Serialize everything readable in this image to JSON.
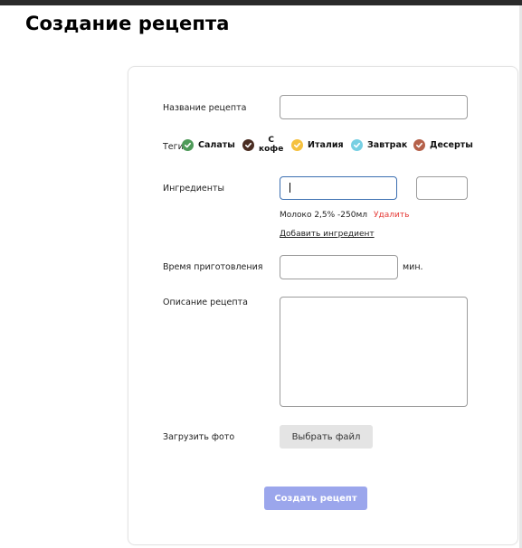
{
  "page": {
    "title": "Создание рецепта"
  },
  "form": {
    "name_label": "Название рецепта",
    "name_value": "",
    "tags_label": "Теги",
    "tags": [
      {
        "lines": [
          "Салаты"
        ],
        "color": "#4e9a59"
      },
      {
        "lines": [
          "С",
          "кофе"
        ],
        "color": "#4a2d22"
      },
      {
        "lines": [
          "Италия"
        ],
        "color": "#f5c13f"
      },
      {
        "lines": [
          "Завтрак"
        ],
        "color": "#76cfe3"
      },
      {
        "lines": [
          "Десерты"
        ],
        "color": "#b5614a"
      }
    ],
    "ingredients_label": "Ингредиенты",
    "ingredient_name_value": "",
    "ingredient_amount_value": "",
    "ingredient_added": "Молоко 2,5% -250мл",
    "remove_label": "Удалить",
    "add_ingredient_label": "Добавить ингредиент",
    "time_label": "Время приготовления",
    "time_value": "",
    "time_unit": "мин.",
    "description_label": "Описание рецепта",
    "description_value": "",
    "photo_label": "Загрузить фото",
    "choose_file_label": "Выбрать файл",
    "submit_label": "Создать рецепт"
  },
  "colors": {
    "submit": "#9ba6ec",
    "remove": "#e53935",
    "focus": "#3c6fb1"
  }
}
